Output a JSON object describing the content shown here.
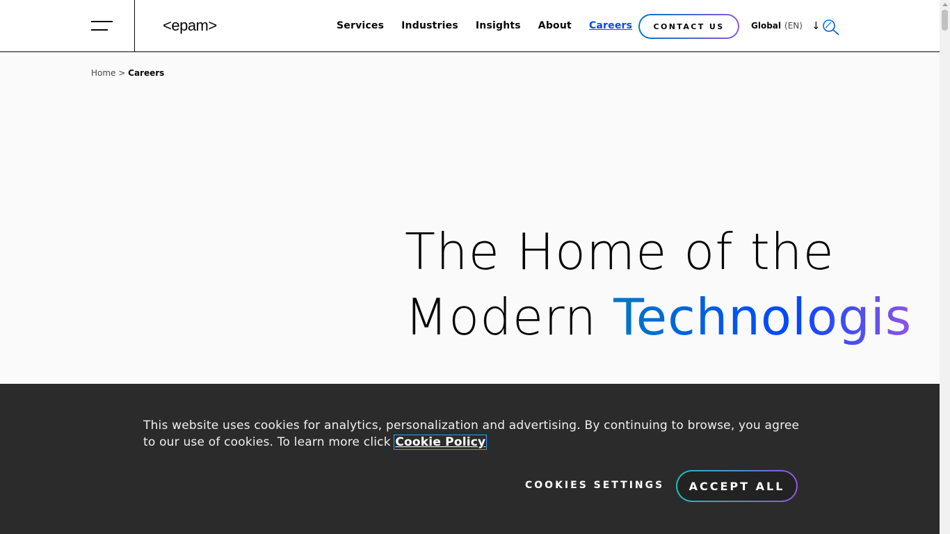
{
  "header": {
    "logo": "<epam>",
    "nav": [
      "Services",
      "Industries",
      "Insights",
      "About",
      "Careers"
    ],
    "active_nav": "Careers",
    "contact_label": "CONTACT US",
    "region": "Global",
    "language": "(EN)"
  },
  "breadcrumb": {
    "home": "Home",
    "separator": ">",
    "current": "Careers"
  },
  "hero": {
    "line1": "The Home of the",
    "line2_plain": "Modern ",
    "line2_highlight": "Technologis"
  },
  "cookie_banner": {
    "text": "This website uses cookies for analytics, personalization and advertising. By continuing to browse, you agree to our use of cookies. To learn more click ",
    "link_label": "Cookie Policy",
    "settings_label": "COOKIES SETTINGS",
    "accept_label": "ACCEPT ALL"
  },
  "colors": {
    "accent_blue": "#0047ff",
    "gradient_start": "#0078c2",
    "gradient_end": "#8e55e3",
    "banner_bg": "#1e1e1e"
  }
}
